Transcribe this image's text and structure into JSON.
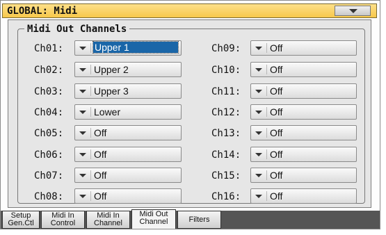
{
  "window": {
    "title": "GLOBAL: Midi"
  },
  "group_title": "Midi Out Channels",
  "channels_left": [
    {
      "label": "Ch01:",
      "value": "Upper 1",
      "selected": true
    },
    {
      "label": "Ch02:",
      "value": "Upper 2"
    },
    {
      "label": "Ch03:",
      "value": "Upper 3"
    },
    {
      "label": "Ch04:",
      "value": "Lower"
    },
    {
      "label": "Ch05:",
      "value": "Off"
    },
    {
      "label": "Ch06:",
      "value": "Off"
    },
    {
      "label": "Ch07:",
      "value": "Off"
    },
    {
      "label": "Ch08:",
      "value": "Off"
    }
  ],
  "channels_right": [
    {
      "label": "Ch09:",
      "value": "Off"
    },
    {
      "label": "Ch10:",
      "value": "Off"
    },
    {
      "label": "Ch11:",
      "value": "Off"
    },
    {
      "label": "Ch12:",
      "value": "Off"
    },
    {
      "label": "Ch13:",
      "value": "Off"
    },
    {
      "label": "Ch14:",
      "value": "Off"
    },
    {
      "label": "Ch15:",
      "value": "Off"
    },
    {
      "label": "Ch16:",
      "value": "Off"
    }
  ],
  "tabs": [
    {
      "line1": "Setup",
      "line2": "Gen.Ctl"
    },
    {
      "line1": "Midi In",
      "line2": "Control"
    },
    {
      "line1": "Midi In",
      "line2": "Channel"
    },
    {
      "line1": "Midi Out",
      "line2": "Channel",
      "active": true
    },
    {
      "line1": "Filters",
      "line2": ""
    }
  ],
  "colors": {
    "title_bar": "#f7c84a",
    "selection": "#1a66a8",
    "panel": "#e6e6e6"
  }
}
